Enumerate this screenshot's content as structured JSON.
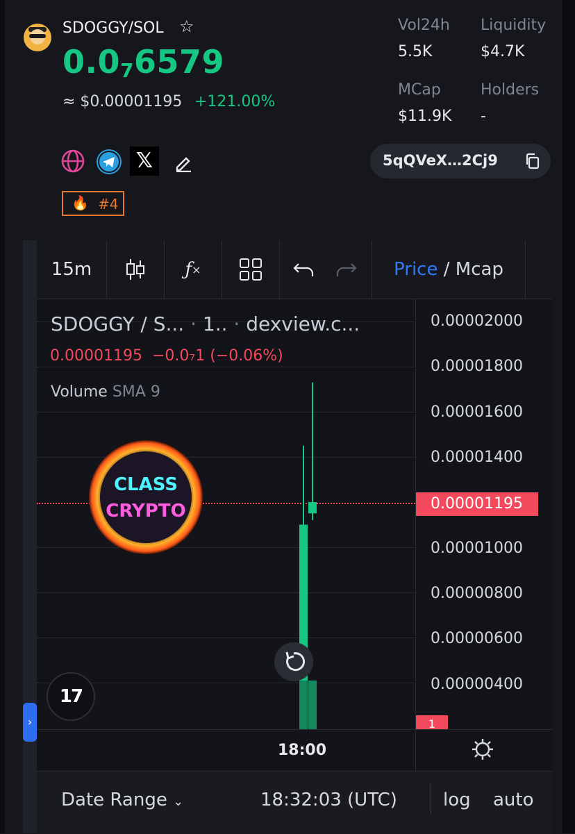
{
  "token": {
    "pair": "SDOGGY/SOL",
    "price_prefix": "0.0",
    "price_zeros": "7",
    "price_digits": "6579",
    "usd_price": "≈ $0.00001195",
    "change_24h": "+121.00%",
    "address_short": "5qQVeX…2Cj9",
    "rank": "#4"
  },
  "stats": {
    "vol24h_label": "Vol24h",
    "vol24h_value": "5.5K",
    "liquidity_label": "Liquidity",
    "liquidity_value": "$4.7K",
    "mcap_label": "MCap",
    "mcap_value": "$11.9K",
    "holders_label": "Holders",
    "holders_value": "-"
  },
  "toolbar": {
    "interval": "15m",
    "price_label": "Price",
    "separator": " / ",
    "mcap_label": "Mcap"
  },
  "chart": {
    "legend_symbol": "SDOGGY / S...",
    "legend_interval": "1..",
    "legend_source": "dexview.c...",
    "legend_price": "0.00001195",
    "legend_change": "−0.0₇1 (−0.06%)",
    "volume_label": "Volume",
    "volume_sma": "SMA 9",
    "current_price_tag": "0.00001195",
    "volume_tag": "1",
    "y_ticks": [
      "0.00002000",
      "0.00001800",
      "0.00001600",
      "0.00001400",
      "0.00001000",
      "0.00000800",
      "0.00000600",
      "0.00000400"
    ],
    "x_tick": "18:00",
    "watermark_line1": "CLASS",
    "watermark_line2": "CRYPTO",
    "tv_logo": "17"
  },
  "footer": {
    "date_range": "Date Range",
    "time": "18:32:03 (UTC)",
    "log": "log",
    "auto": "auto"
  },
  "chart_data": {
    "type": "candlestick",
    "title": "SDOGGY / S...",
    "ylim": [
      2e-06,
      2.14e-05
    ],
    "candles": [
      {
        "x": "18:00",
        "open": 1e-06,
        "high": 1.45e-05,
        "low": 1e-06,
        "close": 1.1e-05
      },
      {
        "x": "18:15",
        "open": 1.15e-05,
        "high": 1.73e-05,
        "low": 1.12e-05,
        "close": 1.2e-05
      }
    ],
    "current_price": 1.195e-05,
    "colors": {
      "up": "#16c784",
      "down": "#f2495c"
    }
  },
  "colors": {
    "accent_green": "#16c784",
    "accent_red": "#f2495c",
    "accent_blue": "#2f7bf5",
    "rank_orange": "#e7782f"
  },
  "icons": [
    "globe-icon",
    "telegram-icon",
    "x-icon",
    "edit-icon",
    "copy-icon",
    "candles-icon",
    "indicators-icon",
    "layout-icon",
    "undo-icon",
    "redo-icon",
    "gear-icon",
    "reset-icon"
  ]
}
